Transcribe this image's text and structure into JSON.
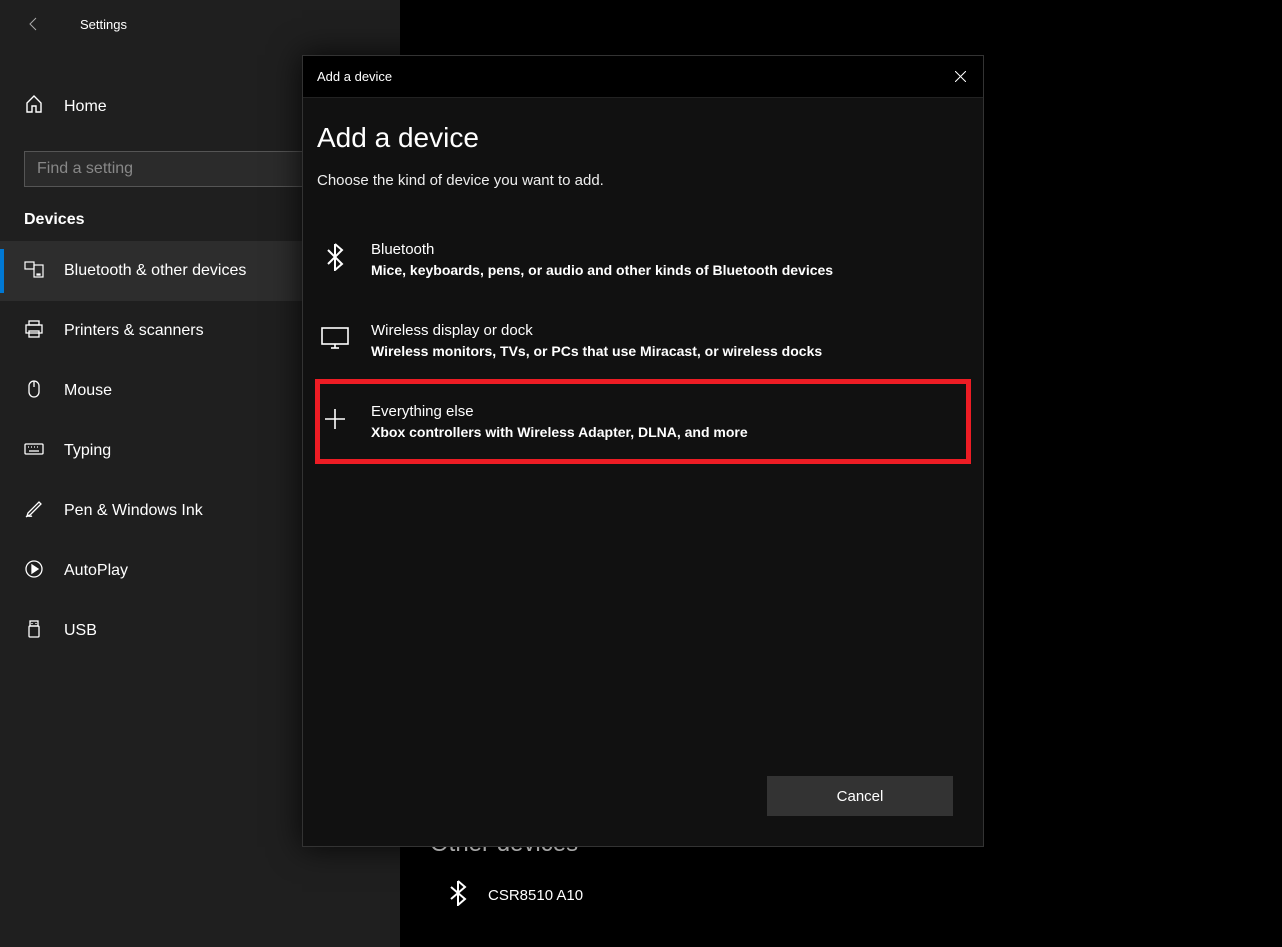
{
  "window": {
    "title": "Settings"
  },
  "sidebar": {
    "home_label": "Home",
    "search_placeholder": "Find a setting",
    "section_label": "Devices",
    "items": [
      {
        "label": "Bluetooth & other devices"
      },
      {
        "label": "Printers & scanners"
      },
      {
        "label": "Mouse"
      },
      {
        "label": "Typing"
      },
      {
        "label": "Pen & Windows Ink"
      },
      {
        "label": "AutoPlay"
      },
      {
        "label": "USB"
      }
    ]
  },
  "content": {
    "other_devices_heading": "Other devices",
    "csr_device": "CSR8510 A10"
  },
  "dialog": {
    "titlebar": "Add a device",
    "heading": "Add a device",
    "subtitle": "Choose the kind of device you want to add.",
    "options": [
      {
        "title": "Bluetooth",
        "desc": "Mice, keyboards, pens, or audio and other kinds of Bluetooth devices"
      },
      {
        "title": "Wireless display or dock",
        "desc": "Wireless monitors, TVs, or PCs that use Miracast, or wireless docks"
      },
      {
        "title": "Everything else",
        "desc": "Xbox controllers with Wireless Adapter, DLNA, and more"
      }
    ],
    "cancel_label": "Cancel"
  },
  "highlight": {
    "color": "#ed1c24"
  }
}
